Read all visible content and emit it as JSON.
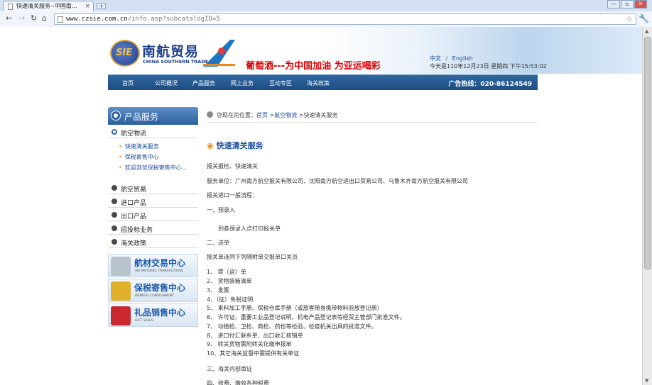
{
  "browser": {
    "tab_title": "快速清关服务--中国南...",
    "tab_close": "×",
    "new_tab": "+",
    "window_buttons": [
      "—",
      "▫",
      "✕"
    ],
    "url_host": "www.czsie.com.cn",
    "url_path": "/info.asp?subcatalogID=5"
  },
  "header": {
    "logo_mark": "SIE",
    "logo_cn": "南航贸易",
    "logo_en": "CHINA SOUTHERN TRADE",
    "marquee": "葡萄酒---为中国加油 为亚运喝彩",
    "lang_cn": "中文",
    "lang_sep": "/",
    "lang_en": "English",
    "date": "今天是110年12月23日 星期四 下午15:53:02"
  },
  "nav": {
    "items": [
      "首页",
      "公司概况",
      "产品服务",
      "网上业务",
      "互动专区",
      "海关政策"
    ],
    "hotline": "广告热线：020-86124549"
  },
  "sidebar": {
    "title": "产品服务",
    "active_category": "航空物流",
    "subitems": [
      "快速清关服务",
      "保税寄售中心",
      "欢迎浏览保税寄售中心..."
    ],
    "categories": [
      "航空贸易",
      "进口产品",
      "出口产品",
      "招投标业务",
      "海关政策"
    ],
    "promos": [
      {
        "cn": "航材交易中心",
        "en": "AIR MATERIEL TRANSACTIONS",
        "color": "#b9c3cc"
      },
      {
        "cn": "保税寄售中心",
        "en": "BONDED CONSIGNMENT",
        "color": "#e0b02a"
      },
      {
        "cn": "礼品销售中心",
        "en": "GIFT SALES",
        "color": "#c8282e"
      }
    ]
  },
  "breadcrumb": {
    "prefix": "您现在的位置：",
    "home": "首页",
    "sep1": " >",
    "cat": "航空物流",
    "current": " >快速清关服务"
  },
  "content": {
    "title": "快速清关服务",
    "lines": [
      "报关报检、快速清关",
      "服务单位：广州南方航空报关有限公司、沈阳南方航空进出口贸易公司、乌鲁木齐南方航空报关有限公司",
      "报关进口一般流程：",
      "一、预录入",
      "到各预录入点打印报关单",
      "二、送单",
      "报关单连同下列随附单交报单口关员",
      "1、 提（运）单",
      "2、 货物装箱清单",
      "3、 发票",
      "4、（征）免税证明",
      "5、 来料加工手册、保税仓库手册（或旅客随身携带物料验放登记册）",
      "6、 许可证、重要工业品登记说明、机电产品登记表等经贸主管部门批准文件。",
      "7、 动植检、卫检、商检、药检等检验、检疫机关出具的批准文件。",
      "8、 进口付汇联系单、出口收汇核销单",
      "9、 转关货物需附转关化缴申报单",
      "10、其它海关监督中需提供有关单证",
      "三、海关内部审证",
      "四、收费、缴收各种税费"
    ]
  }
}
